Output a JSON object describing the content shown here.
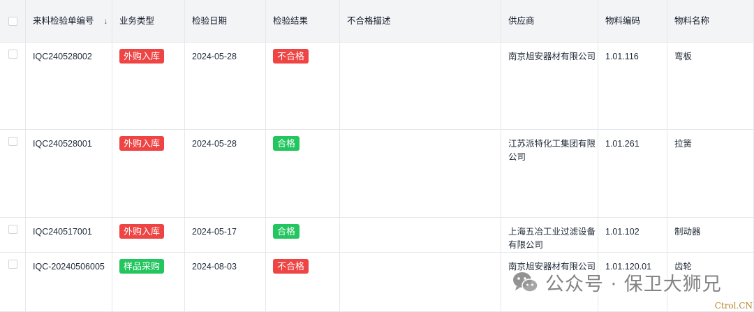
{
  "table": {
    "headers": {
      "code": "来料检验单编号",
      "biz_type": "业务类型",
      "date": "检验日期",
      "result": "检验结果",
      "desc": "不合格描述",
      "supplier": "供应商",
      "material_code": "物料编码",
      "material_name": "物料名称"
    },
    "sort_icon": "↓",
    "rows": [
      {
        "code": "IQC240528002",
        "biz_type": "外购入库",
        "date": "2024-05-28",
        "result": "不合格",
        "desc": "",
        "supplier": "南京旭安器材有限公司",
        "material_code": "1.01.116",
        "material_name": "弯板"
      },
      {
        "code": "IQC240528001",
        "biz_type": "外购入库",
        "date": "2024-05-28",
        "result": "合格",
        "desc": "",
        "supplier": "江苏派特化工集团有限公司",
        "material_code": "1.01.261",
        "material_name": "拉簧"
      },
      {
        "code": "IQC240517001",
        "biz_type": "外购入库",
        "date": "2024-05-17",
        "result": "合格",
        "desc": "",
        "supplier": "上海五冶工业过滤设备有限公司",
        "material_code": "1.01.102",
        "material_name": "制动器"
      },
      {
        "code": "IQC-20240506005",
        "biz_type": "样品采购",
        "date": "2024-08-03",
        "result": "不合格",
        "desc": "",
        "supplier": "南京旭安器材有限公司",
        "material_code": "1.01.120.01",
        "material_name": "齿轮"
      }
    ]
  },
  "colors": {
    "tag_red": "#ef4444",
    "tag_green": "#22c55e",
    "header_bg": "#f3f4f6",
    "border": "#e5e7eb"
  },
  "watermark": {
    "text": "公众号 · 保卫大狮兄",
    "icon": "wechat-icon"
  },
  "corner_mark": "Ctrol.CN"
}
